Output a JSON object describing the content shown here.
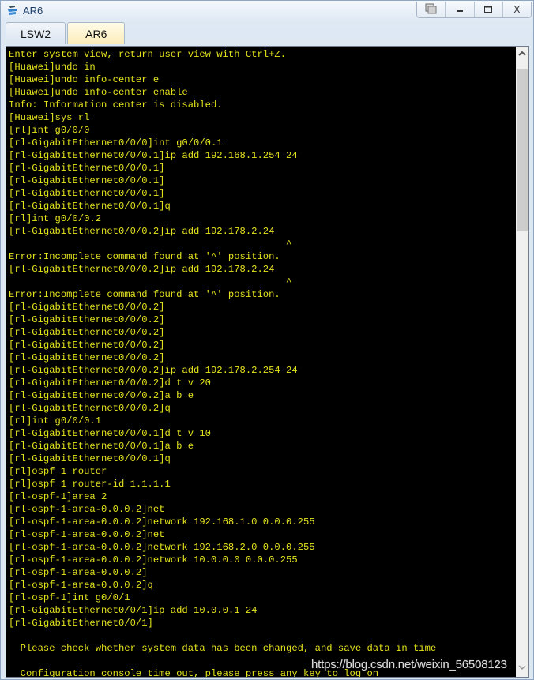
{
  "window": {
    "title": "AR6",
    "app_icon": "ensp-app-icon",
    "controls": {
      "restore_label": "⧉",
      "minimize_label": "—",
      "maximize_label": "▭",
      "close_label": "X"
    }
  },
  "tabs": [
    {
      "label": "LSW2",
      "active": false
    },
    {
      "label": "AR6",
      "active": true
    }
  ],
  "terminal": {
    "colors": {
      "background": "#000000",
      "text": "#e3e31c"
    },
    "lines": [
      "Enter system view, return user view with Ctrl+Z.",
      "[Huawei]undo in",
      "[Huawei]undo info-center e",
      "[Huawei]undo info-center enable",
      "Info: Information center is disabled.",
      "[Huawei]sys rl",
      "[rl]int g0/0/0",
      "[rl-GigabitEthernet0/0/0]int g0/0/0.1",
      "[rl-GigabitEthernet0/0/0.1]ip add 192.168.1.254 24",
      "[rl-GigabitEthernet0/0/0.1]",
      "[rl-GigabitEthernet0/0/0.1]",
      "[rl-GigabitEthernet0/0/0.1]",
      "[rl-GigabitEthernet0/0/0.1]q",
      "[rl]int g0/0/0.2",
      "[rl-GigabitEthernet0/0/0.2]ip add 192.178.2.24",
      "                                                ^",
      "Error:Incomplete command found at '^' position.",
      "[rl-GigabitEthernet0/0/0.2]ip add 192.178.2.24",
      "                                                ^",
      "Error:Incomplete command found at '^' position.",
      "[rl-GigabitEthernet0/0/0.2]",
      "[rl-GigabitEthernet0/0/0.2]",
      "[rl-GigabitEthernet0/0/0.2]",
      "[rl-GigabitEthernet0/0/0.2]",
      "[rl-GigabitEthernet0/0/0.2]",
      "[rl-GigabitEthernet0/0/0.2]ip add 192.178.2.254 24",
      "[rl-GigabitEthernet0/0/0.2]d t v 20",
      "[rl-GigabitEthernet0/0/0.2]a b e",
      "[rl-GigabitEthernet0/0/0.2]q",
      "[rl]int g0/0/0.1",
      "[rl-GigabitEthernet0/0/0.1]d t v 10",
      "[rl-GigabitEthernet0/0/0.1]a b e",
      "[rl-GigabitEthernet0/0/0.1]q",
      "[rl]ospf 1 router",
      "[rl]ospf 1 router-id 1.1.1.1",
      "[rl-ospf-1]area 2",
      "[rl-ospf-1-area-0.0.0.2]net",
      "[rl-ospf-1-area-0.0.0.2]network 192.168.1.0 0.0.0.255",
      "[rl-ospf-1-area-0.0.0.2]net",
      "[rl-ospf-1-area-0.0.0.2]network 192.168.2.0 0.0.0.255",
      "[rl-ospf-1-area-0.0.0.2]network 10.0.0.0 0.0.0.255",
      "[rl-ospf-1-area-0.0.0.2]",
      "[rl-ospf-1-area-0.0.0.2]q",
      "[rl-ospf-1]int g0/0/1",
      "[rl-GigabitEthernet0/0/1]ip add 10.0.0.1 24",
      "[rl-GigabitEthernet0/0/1]",
      "",
      "  Please check whether system data has been changed, and save data in time",
      "",
      "  Configuration console time out, please press any key to log on"
    ]
  },
  "scrollbar": {
    "up_label": "˄",
    "down_label": "˅"
  },
  "watermark": "https://blog.csdn.net/weixin_56508123"
}
